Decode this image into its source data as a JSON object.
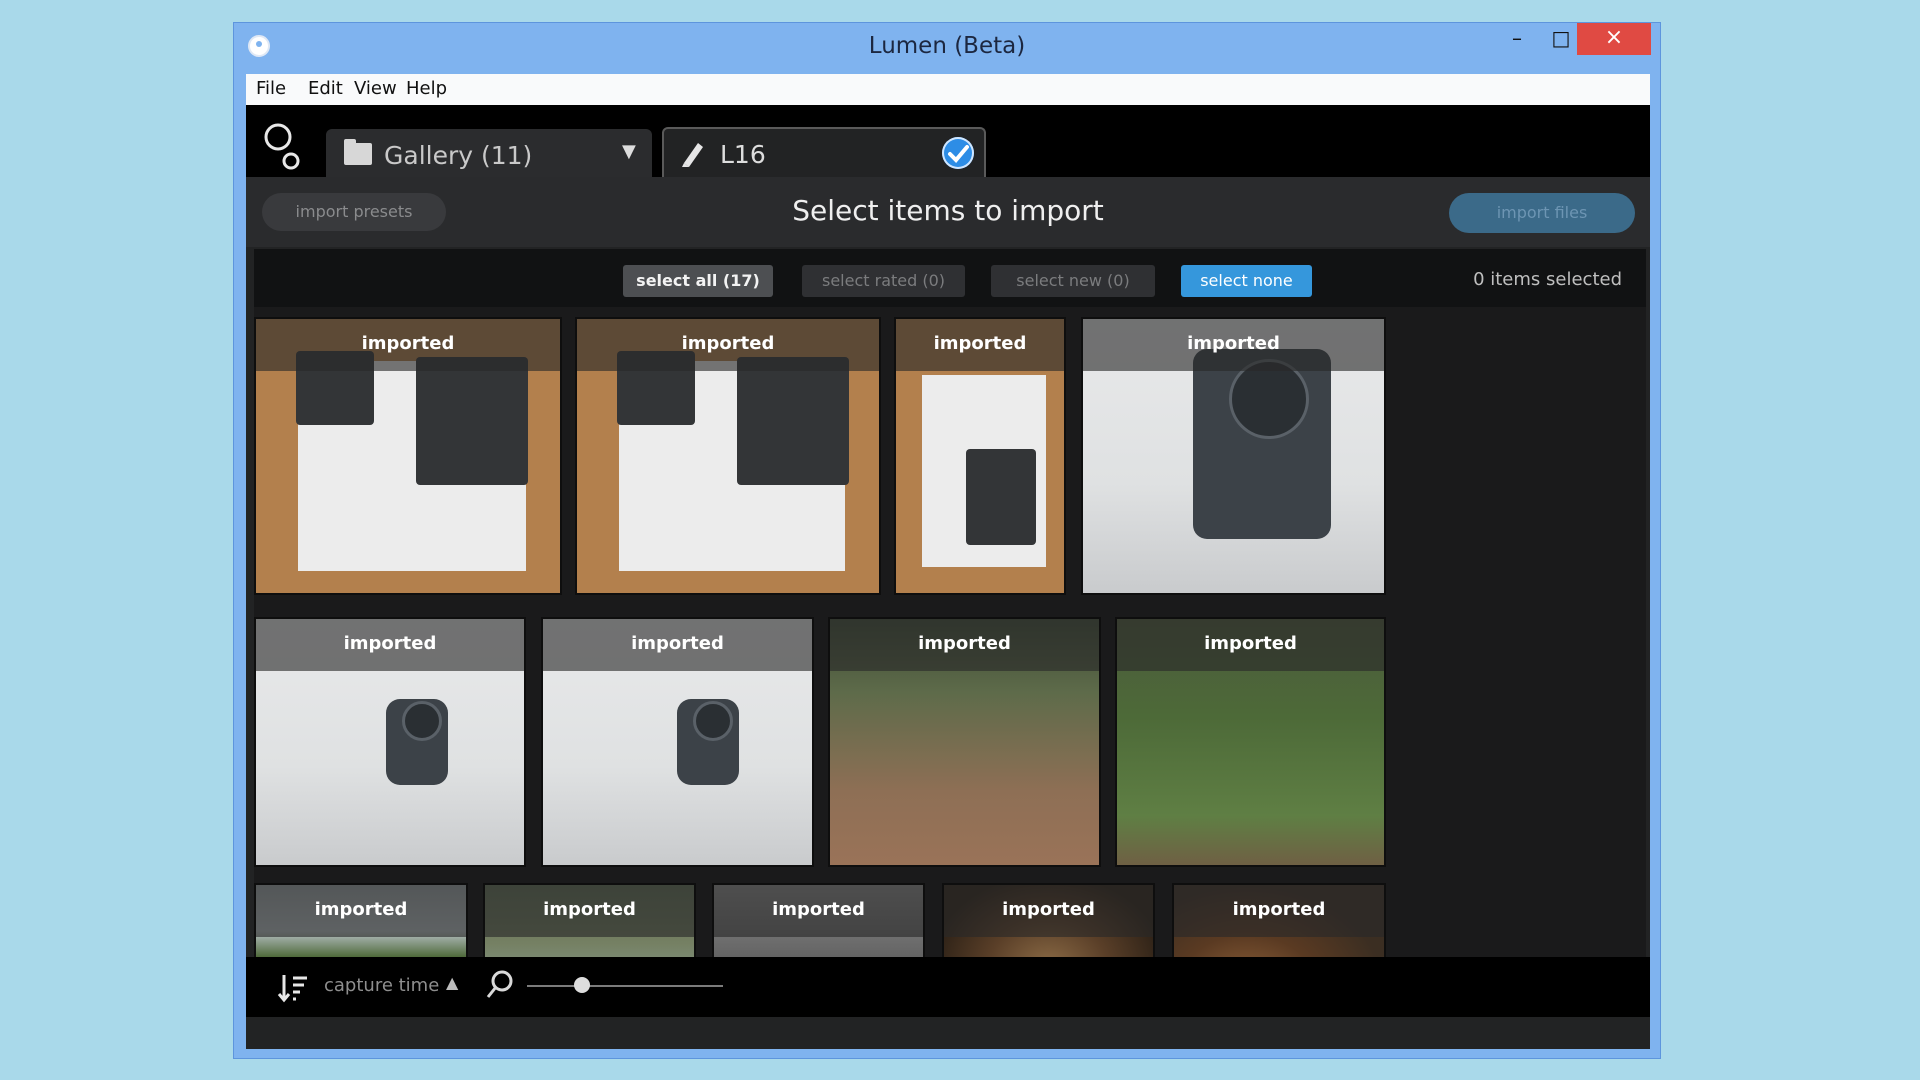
{
  "window": {
    "title": "Lumen (Beta)",
    "minimize": "–",
    "maximize": "□",
    "close": "×"
  },
  "menu": [
    "File",
    "Edit",
    "View",
    "Help"
  ],
  "tabs": {
    "gallery": "Gallery (11)",
    "active": "L16"
  },
  "header": {
    "presets": "import presets",
    "title": "Select items to import",
    "import": "import files"
  },
  "selection": {
    "select_all": "select all (17)",
    "select_rated": "select rated (0)",
    "select_new": "select new (0)",
    "select_none": "select none",
    "count": "0 items selected"
  },
  "thumbs": [
    {
      "label": "imported"
    },
    {
      "label": "imported"
    },
    {
      "label": "imported"
    },
    {
      "label": "imported"
    },
    {
      "label": "imported"
    },
    {
      "label": "imported"
    },
    {
      "label": "imported"
    },
    {
      "label": "imported"
    },
    {
      "label": "imported"
    },
    {
      "label": "imported"
    },
    {
      "label": "imported"
    },
    {
      "label": "imported"
    },
    {
      "label": "imported"
    }
  ],
  "footer": {
    "sort_label": "capture time",
    "zoom_level": 0.33
  },
  "colors": {
    "accent": "#3597dc",
    "close": "#e04a43",
    "titlebar": "#7fb3ef",
    "background": "#a9d9ea"
  },
  "icons": [
    "app-icon",
    "folder-icon",
    "dropdown-arrow-icon",
    "pen-icon",
    "check-circle-icon",
    "sort-icon",
    "sort-direction-icon",
    "search-icon",
    "logo-icon"
  ]
}
